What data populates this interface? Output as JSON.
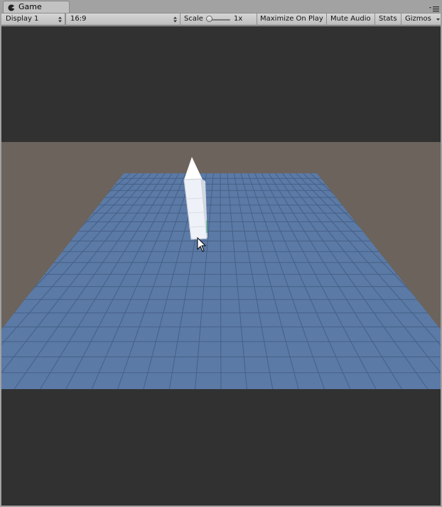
{
  "window": {
    "tab_title": "Game",
    "tab_icon": "pacman-icon",
    "menu_icon": "panel-menu-icon"
  },
  "toolbar": {
    "display": "Display 1",
    "aspect": "16:9",
    "scale_label": "Scale",
    "scale_value": "1x",
    "scale_fraction": 0.0,
    "maximize_label": "Maximize On Play",
    "mute_label": "Mute Audio",
    "stats_label": "Stats",
    "gizmos_label": "Gizmos"
  },
  "viewport": {
    "letterbox_color": "#313131",
    "sky_color": "#6b635c",
    "plane_color": "#5b7aa6",
    "grid_color": "#3f587c",
    "object_color": "#eef2f8",
    "cursor_icon": "mouse-pointer-icon"
  }
}
